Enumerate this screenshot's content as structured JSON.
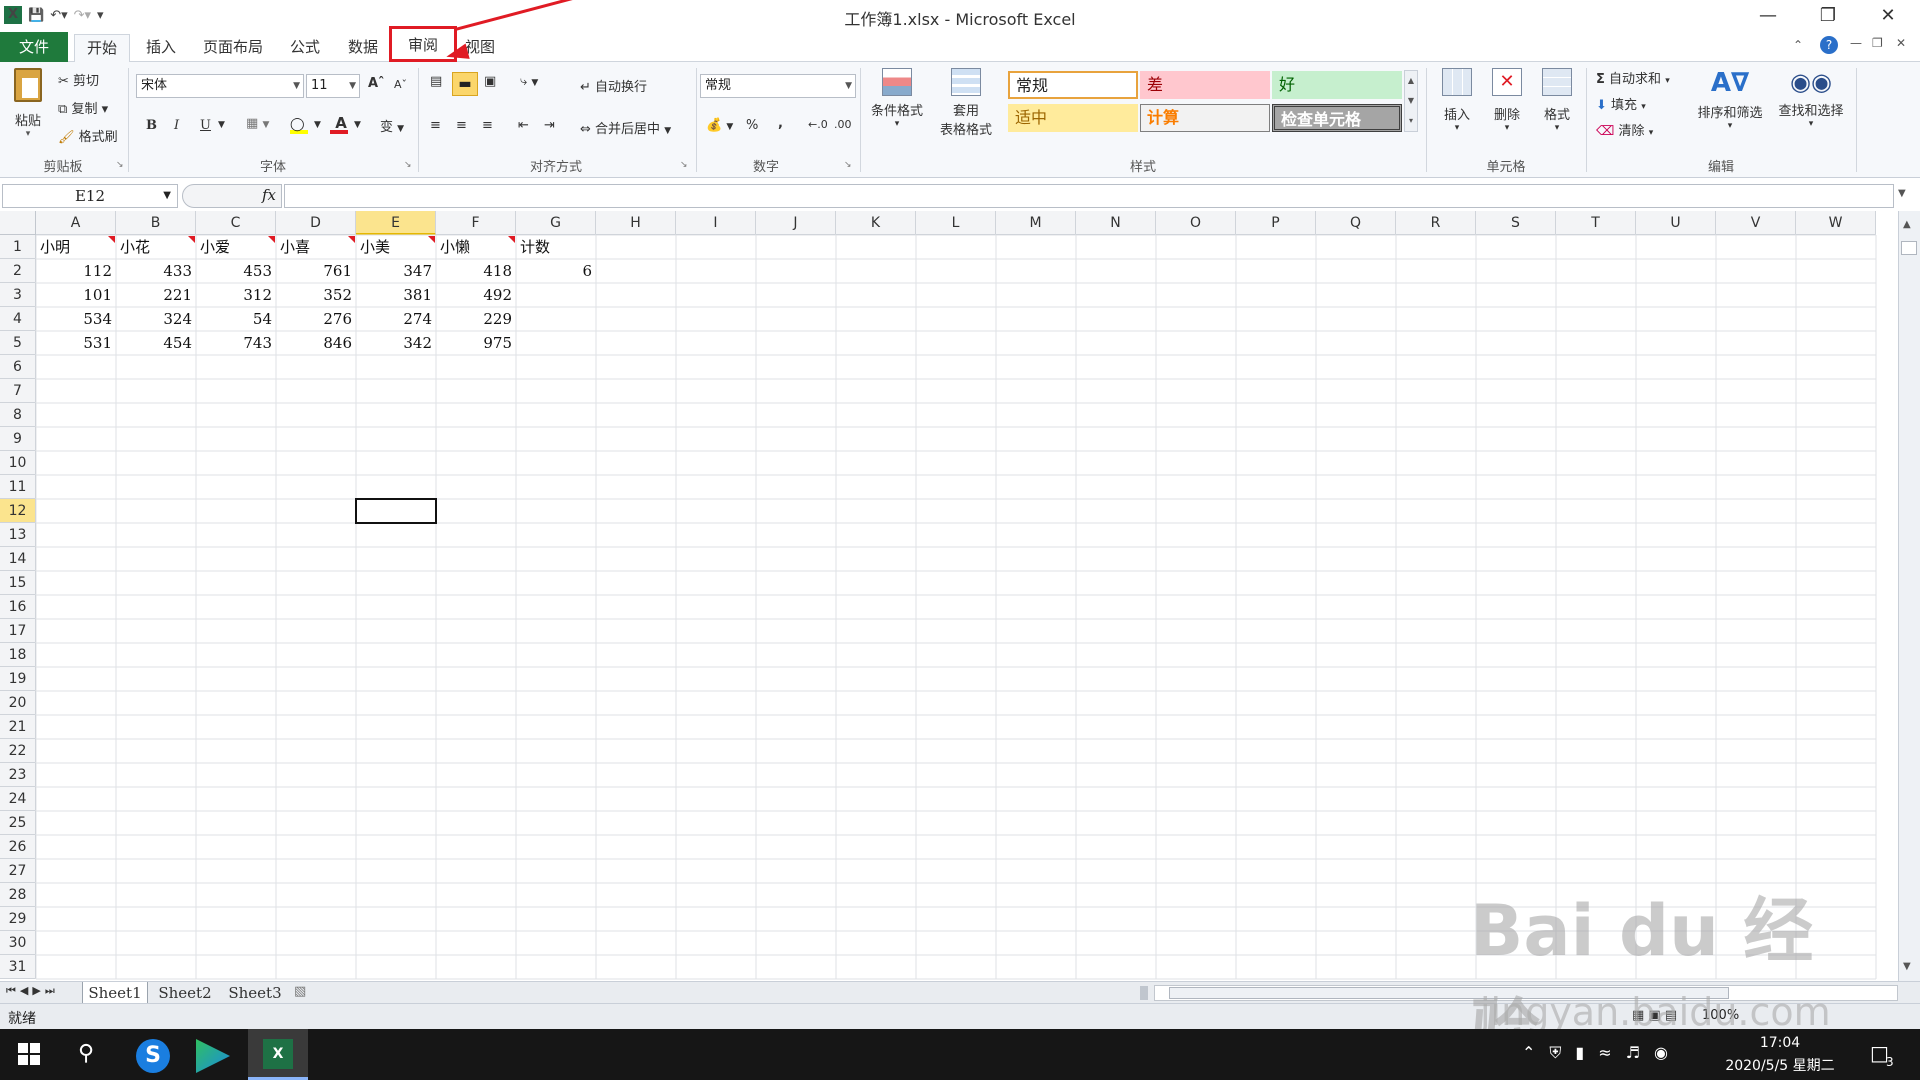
{
  "window": {
    "title": "工作簿1.xlsx - Microsoft Excel"
  },
  "tabs": {
    "file": "文件",
    "home": "开始",
    "insert": "插入",
    "page_layout": "页面布局",
    "formulas": "公式",
    "data": "数据",
    "review": "审阅",
    "view": "视图"
  },
  "ribbon": {
    "clipboard": {
      "paste": "粘贴",
      "cut": "剪切",
      "copy": "复制",
      "format_painter": "格式刷",
      "label": "剪贴板"
    },
    "font": {
      "name": "宋体",
      "size": "11",
      "bold": "B",
      "italic": "I",
      "underline": "U",
      "wen": "变",
      "label": "字体"
    },
    "alignment": {
      "wrap": "自动换行",
      "merge": "合并后居中",
      "label": "对齐方式"
    },
    "number": {
      "format": "常规",
      "percent": "%",
      "comma": ",",
      "label": "数字"
    },
    "styles": {
      "conditional": "条件格式",
      "table1": "套用",
      "table2": "表格格式",
      "normal": "常规",
      "bad": "差",
      "good": "好",
      "neutral": "适中",
      "calc": "计算",
      "check": "检查单元格",
      "label": "样式"
    },
    "cells": {
      "insert": "插入",
      "delete": "删除",
      "format": "格式",
      "label": "单元格"
    },
    "editing": {
      "autosum": "自动求和",
      "fill": "填充",
      "clear": "清除",
      "sort": "排序和筛选",
      "find": "查找和选择",
      "label": "编辑"
    }
  },
  "formula_bar": {
    "name_box": "E12",
    "fx": "fx",
    "value": ""
  },
  "sheet": {
    "columns": [
      "A",
      "B",
      "C",
      "D",
      "E",
      "F",
      "G",
      "H",
      "I",
      "J",
      "K",
      "L",
      "M",
      "N",
      "O",
      "P",
      "Q",
      "R",
      "S",
      "T",
      "U",
      "V",
      "W"
    ],
    "rows": [
      "1",
      "2",
      "3",
      "4",
      "5",
      "6",
      "7",
      "8",
      "9",
      "10",
      "11",
      "12",
      "13",
      "14",
      "15",
      "16",
      "17",
      "18",
      "19",
      "20",
      "21",
      "22",
      "23",
      "24",
      "25",
      "26",
      "27",
      "28",
      "29",
      "30",
      "31"
    ],
    "headers": [
      "小明",
      "小花",
      "小爱",
      "小喜",
      "小美",
      "小懒",
      "计数"
    ],
    "data": [
      [
        "112",
        "433",
        "453",
        "761",
        "347",
        "418",
        "6"
      ],
      [
        "101",
        "221",
        "312",
        "352",
        "381",
        "492",
        ""
      ],
      [
        "534",
        "324",
        "54",
        "276",
        "274",
        "229",
        ""
      ],
      [
        "531",
        "454",
        "743",
        "846",
        "342",
        "975",
        ""
      ]
    ],
    "selected_cell": "E12"
  },
  "sheet_tabs": [
    "Sheet1",
    "Sheet2",
    "Sheet3"
  ],
  "status": {
    "ready": "就绪",
    "zoom": "100%"
  },
  "taskbar": {
    "time": "17:04",
    "date": "2020/5/5 星期二",
    "notif": "3"
  },
  "watermark": {
    "brand": "Bai du 经验",
    "url": "jingyan.baidu.com"
  },
  "colors": {
    "file_tab": "#1f7a3c",
    "highlight": "#e01b24",
    "selection_header": "#fbe48e"
  }
}
